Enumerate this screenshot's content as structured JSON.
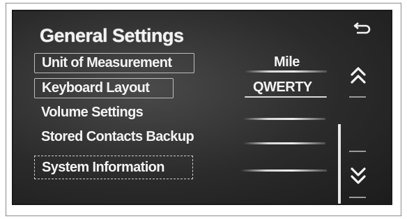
{
  "screen": {
    "title": "General Settings"
  },
  "nav": {
    "back_icon": "back-arrow-icon",
    "scroll_up_icon": "double-chevron-up-icon",
    "scroll_down_icon": "double-chevron-down-icon"
  },
  "settings": {
    "items": [
      {
        "label": "Unit of Measurement",
        "value": "Mile"
      },
      {
        "label": "Keyboard Layout",
        "value": "QWERTY"
      },
      {
        "label": "Volume Settings",
        "value": ""
      },
      {
        "label": "Stored Contacts Backup",
        "value": ""
      },
      {
        "label": "System Information",
        "value": ""
      }
    ]
  },
  "colors": {
    "screen_bg": "#2b2b2b",
    "text": "#f4f4f4"
  }
}
